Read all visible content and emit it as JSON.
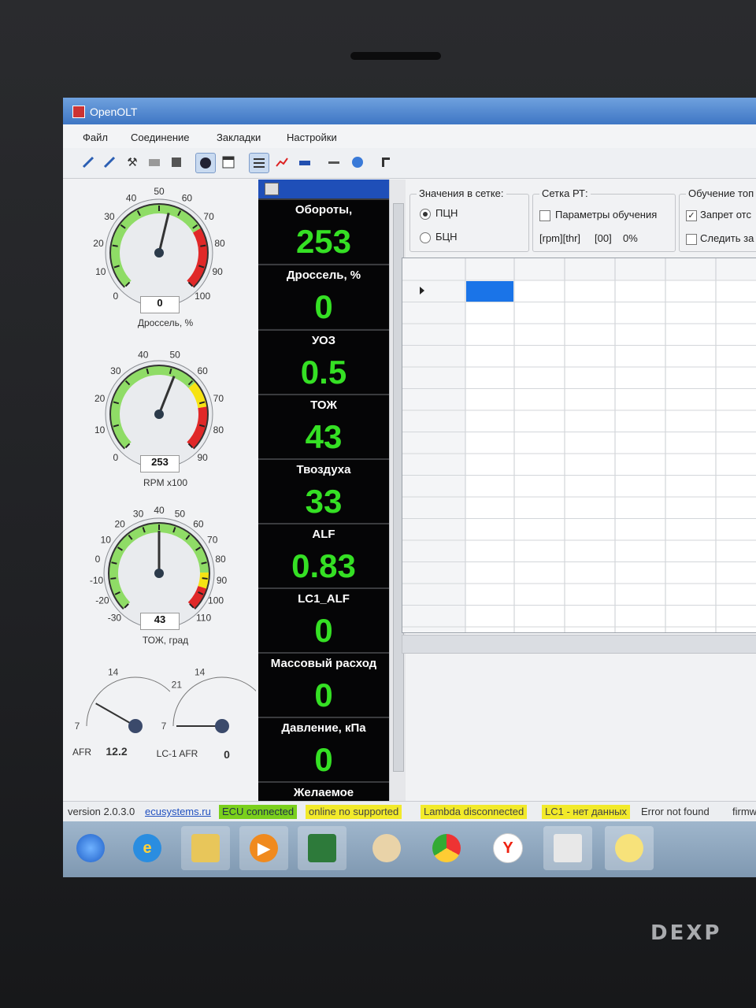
{
  "window": {
    "title": "OpenOLT"
  },
  "menu": [
    "Файл",
    "Соединение",
    "Закладки",
    "Настройки"
  ],
  "toolbar_icons": [
    "pen-icon",
    "pen-icon",
    "tools-icon",
    "ecu-icon",
    "save-icon",
    "gauge-icon",
    "window-icon",
    "list-icon",
    "chart-icon",
    "car-icon",
    "dash-icon",
    "clock-icon",
    "pin-icon"
  ],
  "gauges": {
    "throttle": {
      "ticks": [
        "0",
        "10",
        "20",
        "30",
        "40",
        "50",
        "60",
        "70",
        "80",
        "90",
        "100"
      ],
      "value": "0",
      "label": "Дроссель, %",
      "needle_fraction": 0.55
    },
    "rpm": {
      "ticks": [
        "0",
        "10",
        "20",
        "30",
        "40",
        "50",
        "60",
        "70",
        "80",
        "90"
      ],
      "value": "253",
      "label": "RPM x100",
      "needle_fraction": 0.58
    },
    "coolant": {
      "ticks": [
        "-30",
        "-20",
        "-10",
        "0",
        "10",
        "20",
        "30",
        "40",
        "50",
        "60",
        "70",
        "80",
        "90",
        "100",
        "110"
      ],
      "value": "43",
      "label": "ТОЖ, град",
      "needle_fraction": 0.5
    },
    "afr": {
      "ticks": [
        "7",
        "14",
        "21"
      ],
      "value": "12.2",
      "label": "AFR"
    },
    "lc1": {
      "ticks": [
        "7",
        "14",
        "21"
      ],
      "value": "0",
      "label": "LC-1 AFR"
    }
  },
  "tiles": [
    {
      "label": "Обороты,",
      "value": "253"
    },
    {
      "label": "Дроссель, %",
      "value": "0"
    },
    {
      "label": "УОЗ",
      "value": "0.5"
    },
    {
      "label": "ТОЖ",
      "value": "43"
    },
    {
      "label": "Твоздуха",
      "value": "33"
    },
    {
      "label": "ALF",
      "value": "0.83"
    },
    {
      "label": "LC1_ALF",
      "value": "0"
    },
    {
      "label": "Массовый расход",
      "value": "0"
    },
    {
      "label": "Давление, кПа",
      "value": "0"
    },
    {
      "label": "Желаемое",
      "value": ""
    }
  ],
  "grid_values": {
    "title": "Значения в сетке:",
    "options": [
      {
        "label": "ПЦН",
        "selected": true
      },
      {
        "label": "БЦН",
        "selected": false
      }
    ]
  },
  "grid_rt": {
    "title": "Сетка РТ:",
    "checkbox_label": "Параметры обучения",
    "checked": false,
    "fields": [
      "[rpm][thr]",
      "[00]",
      "0%"
    ]
  },
  "training": {
    "title": "Обучение топ",
    "items": [
      {
        "label": "Запрет отс",
        "checked": true
      },
      {
        "label": "Следить за",
        "checked": false
      }
    ]
  },
  "status": {
    "version": "version 2.0.3.0",
    "site": "ecusystems.ru",
    "ecu": "ECU connected",
    "online": "online no supported",
    "lambda": "Lambda disconnected",
    "lc1": "LC1 - нет данных",
    "error": "Error not found",
    "firmware": "firmw"
  },
  "colors": {
    "title_bar": "#3e76c4",
    "value_green": "#35e024",
    "gauge_green": "#8fdc66",
    "gauge_red": "#e02828",
    "gauge_yellow": "#f6e313",
    "status_yellow": "#f2ea2a",
    "status_green": "#7ad01c",
    "grid_selected": "#1a74e8"
  },
  "brand": "DEXP"
}
